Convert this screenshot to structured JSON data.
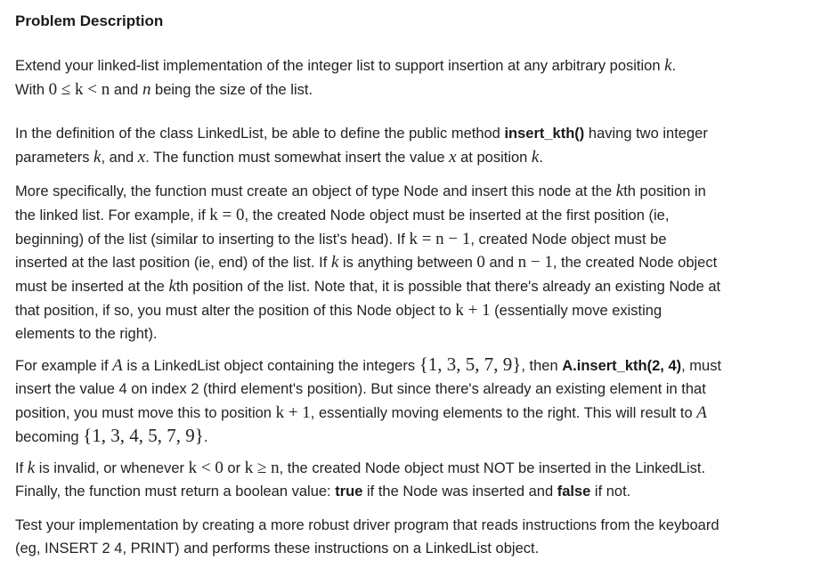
{
  "title": "Problem Description",
  "p1": {
    "l1a": "Extend your linked-list implementation of the integer list to support insertion at any arbitrary position ",
    "k": "k",
    "l1b": ".",
    "l2a": "With ",
    "l2math": "0 ≤ k < n",
    "l2b": " and ",
    "n": "n",
    "l2c": " being the size of the list."
  },
  "p2": {
    "l1a": "In the definition of the class LinkedList, be able to define the public method ",
    "method": "insert_kth()",
    "l1b": " having two integer",
    "l2a": "parameters ",
    "k": "k",
    "l2b": ", and ",
    "x": "x",
    "l2c": ". The function must somewhat insert the value ",
    "x2": "x",
    "l2d": " at position ",
    "k2": "k",
    "l2e": "."
  },
  "p3": {
    "l1a": "More specifically, the function must create an object of type Node and insert this node at the ",
    "k": "k",
    "l1b": "th position in",
    "l2a": "the linked list. For example, if ",
    "m1": "k = 0",
    "l2b": ", the created Node object  must be inserted at the first position (ie,",
    "l3": "beginning) of the list (similar to inserting to the list's head). If ",
    "m2": "k = n − 1",
    "l3b": ", created Node object  must be",
    "l4a": "inserted at the last position (ie, end) of the list. If ",
    "k2": "k",
    "l4b": " is anything between ",
    "zero": "0",
    "l4c": " and ",
    "m3": "n − 1",
    "l4d": ", the created Node object",
    "l5a": "must be inserted at the ",
    "k3": "k",
    "l5b": "th position of the list. Note that, it is possible that there's already an existing Node at",
    "l6a": "that position, if so, you must alter the position of this Node object to ",
    "m4": "k + 1",
    "l6b": " (essentially move existing",
    "l7": "elements to the right)."
  },
  "p4": {
    "l1a": "For example if ",
    "A": "A",
    "l1b": " is a LinkedList object containing the integers ",
    "set1": "{1, 3, 5, 7, 9}",
    "l1c": ", then ",
    "call": "A.insert_kth(2, 4)",
    "l1d": ", must",
    "l2": "insert the value 4 on index 2 (third element's position). But since there's already an existing element in that",
    "l3a": "position, you must move this to position ",
    "m1": "k + 1",
    "l3b": ", essentially moving elements to the right. This will result to ",
    "A2": "A",
    "l4a": "becoming ",
    "set2": "{1, 3, 4, 5, 7, 9}",
    "l4b": "."
  },
  "p5": {
    "l1a": "If ",
    "k": "k",
    "l1b": " is invalid, or whenever ",
    "m1": "k < 0",
    "l1c": " or ",
    "m2": "k ≥ n",
    "l1d": ", the created Node object must NOT be inserted in the LinkedList.",
    "l2a": "Finally, the function must return a boolean value: ",
    "true": "true",
    "l2b": " if the Node was inserted and ",
    "false": "false",
    "l2c": " if not."
  },
  "p6": {
    "l1": "Test your implementation by creating a more robust driver program that reads instructions from the keyboard",
    "l2": "(eg, INSERT 2 4, PRINT) and performs these instructions on a LinkedList object."
  }
}
